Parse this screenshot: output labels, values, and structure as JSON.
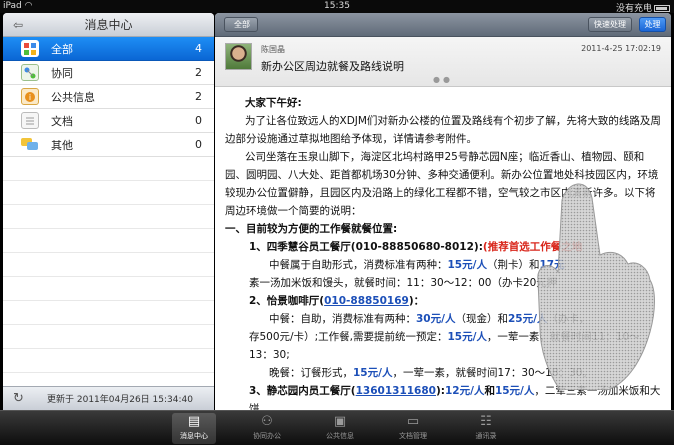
{
  "status_bar": {
    "device": "iPad",
    "time": "15:35",
    "charging": "没有充电"
  },
  "sidebar": {
    "title": "消息中心",
    "items": [
      {
        "label": "全部",
        "count": "4",
        "icon": "all-grid-icon",
        "selected": true
      },
      {
        "label": "协同",
        "count": "2",
        "icon": "collaboration-icon",
        "selected": false
      },
      {
        "label": "公共信息",
        "count": "2",
        "icon": "public-info-icon",
        "selected": false
      },
      {
        "label": "文档",
        "count": "0",
        "icon": "document-icon",
        "selected": false
      },
      {
        "label": "其他",
        "count": "0",
        "icon": "chat-bubbles-icon",
        "selected": false
      }
    ],
    "footer_updated": "更新于 2011年04月26日 15:34:40"
  },
  "detail": {
    "back_label": "全部",
    "quick_label": "快速处理",
    "process_label": "处理",
    "sender": "陈国晶",
    "datetime": "2011-4-25 17:02:19",
    "subject": "新办公区周边就餐及路线说明",
    "body": {
      "greeting": "大家下午好:",
      "p1": "为了让各位致远人的XDJM们对新办公楼的位置及路线有个初步了解，先将大致的线路及周边部分设施通过草拟地图给予体现，详情请参考附件。",
      "p2": "公司坐落在玉泉山脚下，海淀区北坞村路甲25号静芯园N座；临近香山、植物园、颐和园、圆明园、八大处、距首都机场30分钟、多种交通便利。新办公位置地处科技园区内，环境较现办公位置僻静，且园区内及沿路上的绿化工程都不错，空气较之市区内清新许多。以下将周边环境做一个简要的说明：",
      "sec1": "一、目前较为方便的工作餐就餐位置:",
      "item1_title": "1、四季慧谷员工餐厅(010-88850680-8012):",
      "item1_note": "(推荐首选工作餐之地",
      "item1_line1_a": "中餐属于自助形式，消费标准有两种：",
      "item1_price1": "15元/人",
      "item1_line1_b": "（荆卡）和",
      "item1_price2": "17元",
      "item1_line2": "素一汤加米饭和馒头，就餐时间：11：30～12：00（办卡20元押",
      "item2_prefix": "2、怡景咖啡厅(",
      "item2_phone": "010-88850169",
      "item2_suffix": ")：",
      "item2_l1_a": "中餐：自助，消费标准有两种：",
      "item2_price1": "30元/人",
      "item2_l1_b": "（现金）和",
      "item2_price2": "25元/人",
      "item2_l1_c": "（办卡，",
      "item2_l2_a": "存500元/卡）;工作餐,需要提前统一预定：",
      "item2_price3": "15元/人",
      "item2_l2_b": "，一荤一素，就餐时间11：10～",
      "item2_l3": "13：30;",
      "item2_l4_a": "晚餐：订餐形式，",
      "item2_price4": "15元/人",
      "item2_l4_b": "，一荤一素，就餐时间17：30～18：30。",
      "item3_prefix": "3、静芯园内员工餐厅(",
      "item3_phone": "13601311680",
      "item3_mid": "):",
      "item3_price1": "12元/人",
      "item3_and": "和",
      "item3_price2": "15元/人",
      "item3_tail": "，二荤三素一汤加米饭和大饼，"
    }
  },
  "tabbar": {
    "tabs": [
      {
        "label": "消息中心",
        "icon": "message-center-icon",
        "active": true
      },
      {
        "label": "协同办公",
        "icon": "collaboration-icon",
        "active": false
      },
      {
        "label": "公共信息",
        "icon": "public-info-icon",
        "active": false
      },
      {
        "label": "文档管理",
        "icon": "document-icon",
        "active": false
      },
      {
        "label": "通讯录",
        "icon": "contacts-icon",
        "active": false
      }
    ]
  },
  "colors": {
    "selected_row": "#0a66d4",
    "price_blue": "#1c4fb8",
    "note_red": "#d9261b"
  }
}
